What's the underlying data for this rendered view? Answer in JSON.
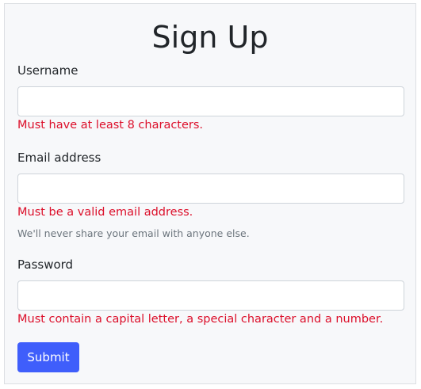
{
  "form": {
    "title": "Sign Up",
    "username": {
      "label": "Username",
      "value": "",
      "error": "Must have at least 8 characters."
    },
    "email": {
      "label": "Email address",
      "value": "",
      "error": "Must be a valid email address.",
      "help": "We'll never share your email with anyone else."
    },
    "password": {
      "label": "Password",
      "value": "",
      "error": "Must contain a capital letter, a special character and a number."
    },
    "submit_label": "Submit"
  },
  "colors": {
    "error": "#dc0f2a",
    "primary": "#3f5efb",
    "help": "#6c757d"
  }
}
